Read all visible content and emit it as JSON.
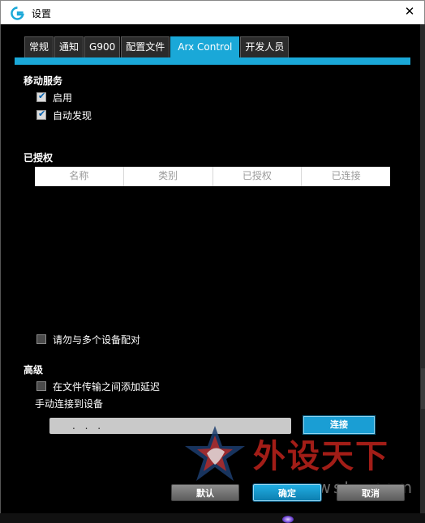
{
  "window": {
    "title": "设置",
    "close_icon": "close-icon",
    "logo_icon": "logitech-g-logo"
  },
  "tabs": [
    {
      "label": "常规",
      "active": false
    },
    {
      "label": "通知",
      "active": false
    },
    {
      "label": "G900",
      "active": false
    },
    {
      "label": "配置文件",
      "active": false
    },
    {
      "label": "Arx Control",
      "active": true
    },
    {
      "label": "开发人员",
      "active": false
    }
  ],
  "mobile_service": {
    "title": "移动服务",
    "enable": {
      "label": "启用",
      "checked": true
    },
    "auto_discover": {
      "label": "自动发现",
      "checked": true
    }
  },
  "authorized": {
    "title": "已授权",
    "columns": [
      "名称",
      "类别",
      "已授权",
      "已连接"
    ],
    "rows": [],
    "no_multi_pair": {
      "label": "请勿与多个设备配对",
      "checked": false
    }
  },
  "advanced": {
    "title": "高级",
    "add_delay": {
      "label": "在文件传输之间添加延迟",
      "checked": false
    },
    "manual_connect_label": "手动连接到设备",
    "address_value": ". . .",
    "connect_label": "连接"
  },
  "footer": {
    "default_label": "默认",
    "ok_label": "确定",
    "cancel_label": "取消"
  },
  "watermark": {
    "text": "外设天下",
    "url": "www.wstx.com"
  },
  "colors": {
    "accent": "#1aa8d8",
    "background": "#000000"
  }
}
